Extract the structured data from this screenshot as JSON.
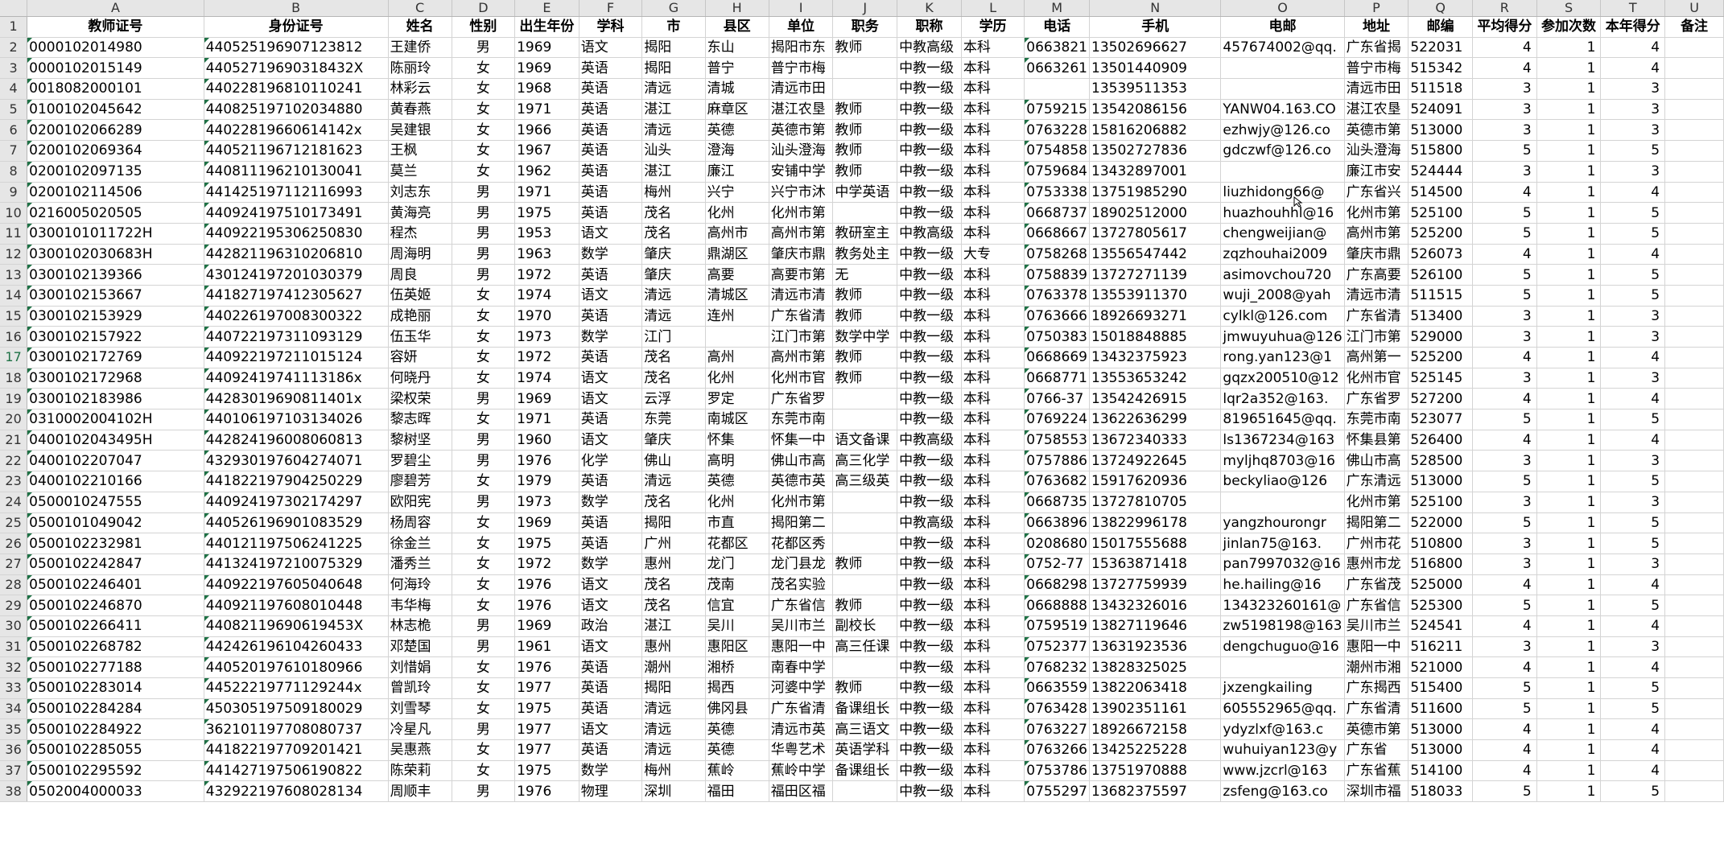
{
  "sheet": {
    "column_letters": [
      "A",
      "B",
      "C",
      "D",
      "E",
      "F",
      "G",
      "H",
      "I",
      "J",
      "K",
      "L",
      "M",
      "N",
      "O",
      "P",
      "Q",
      "R",
      "S",
      "T",
      "U"
    ],
    "headers": [
      "教师证号",
      "身份证号",
      "姓名",
      "性别",
      "出生年份",
      "学科",
      "市",
      "县区",
      "单位",
      "职务",
      "职称",
      "学历",
      "电话",
      "手机",
      "电邮",
      "地址",
      "邮编",
      "平均得分",
      "参加次数",
      "本年得分",
      "备注"
    ],
    "rows": [
      [
        "0000102014980",
        "440525196907123812",
        "王建侨",
        "男",
        "1969",
        "语文",
        "揭阳",
        "东山",
        "揭阳市东",
        "教师",
        "中教高级",
        "本科",
        "0663821",
        "13502696627",
        "457674002@qq.",
        "广东省揭",
        "522031",
        "4",
        "1",
        "4",
        ""
      ],
      [
        "0000102015149",
        "44052719690318432X",
        "陈丽玲",
        "女",
        "1969",
        "英语",
        "揭阳",
        "普宁",
        "普宁市梅",
        "",
        "中教一级",
        "本科",
        "0663261",
        "13501440909",
        "",
        "普宁市梅",
        "515342",
        "4",
        "1",
        "4",
        ""
      ],
      [
        "0018082000101",
        "440228196810110241",
        "林彩云",
        "女",
        "1968",
        "英语",
        "清远",
        "清城",
        "清远市田",
        "",
        "中教一级",
        "本科",
        "",
        "13539511353",
        "",
        "清远市田",
        "511518",
        "3",
        "1",
        "3",
        ""
      ],
      [
        "0100102045642",
        "440825197102034880",
        "黄春燕",
        "女",
        "1971",
        "英语",
        "湛江",
        "麻章区",
        "湛江农垦",
        "教师",
        "中教一级",
        "本科",
        "0759215",
        "13542086156",
        "YANW04.163.CO",
        "湛江农垦",
        "524091",
        "3",
        "1",
        "3",
        ""
      ],
      [
        "0200102066289",
        "44022819660614142x",
        "吴建银",
        "女",
        "1966",
        "英语",
        "清远",
        "英德",
        "英德市第",
        "教师",
        "中教一级",
        "本科",
        "0763228",
        "15816206882",
        "ezhwjy@126.co",
        "英德市第",
        "513000",
        "3",
        "1",
        "3",
        ""
      ],
      [
        "0200102069364",
        "440521196712181623",
        "王枫",
        "女",
        "1967",
        "英语",
        "汕头",
        "澄海",
        "汕头澄海",
        "教师",
        "中教一级",
        "本科",
        "0754858",
        "13502727836",
        "gdczwf@126.co",
        "汕头澄海",
        "515800",
        "5",
        "1",
        "5",
        ""
      ],
      [
        "0200102097135",
        "440811196210130041",
        "莫兰",
        "女",
        "1962",
        "英语",
        "湛江",
        "廉江",
        "安铺中学",
        "教师",
        "中教一级",
        "本科",
        "0759684",
        "13432897001",
        "",
        "廉江市安",
        "524444",
        "3",
        "1",
        "3",
        ""
      ],
      [
        "0200102114506",
        "441425197112116993",
        "刘志东",
        "男",
        "1971",
        "英语",
        "梅州",
        "兴宁",
        "兴宁市沐",
        "中学英语",
        "中教一级",
        "本科",
        "0753338",
        "13751985290",
        "liuzhidong66@",
        "广东省兴",
        "514500",
        "4",
        "1",
        "4",
        ""
      ],
      [
        "0216005020505",
        "440924197510173491",
        "黄海亮",
        "男",
        "1975",
        "英语",
        "茂名",
        "化州",
        "化州市第",
        "",
        "中教一级",
        "本科",
        "0668737",
        "18902512000",
        "huazhouhhl@16",
        "化州市第",
        "525100",
        "5",
        "1",
        "5",
        ""
      ],
      [
        "0300101011722H",
        "440922195306250830",
        "程杰",
        "男",
        "1953",
        "语文",
        "茂名",
        "高州市",
        "高州市第",
        "教研室主",
        "中教高级",
        "本科",
        "0668667",
        "13727805617",
        "chengweijian@",
        "高州市第",
        "525200",
        "5",
        "1",
        "5",
        ""
      ],
      [
        "0300102030683H",
        "442821196310206810",
        "周海明",
        "男",
        "1963",
        "数学",
        "肇庆",
        "鼎湖区",
        "肇庆市鼎",
        "教务处主",
        "中教一级",
        "大专",
        "0758268",
        "13556547442",
        "zqzhouhai2009",
        "肇庆市鼎",
        "526073",
        "4",
        "1",
        "4",
        ""
      ],
      [
        "0300102139366",
        "430124197201030379",
        "周良",
        "男",
        "1972",
        "英语",
        "肇庆",
        "高要",
        "高要市第",
        "无",
        "中教一级",
        "本科",
        "0758839",
        "13727271139",
        "asimovchou720",
        "广东高要",
        "526100",
        "5",
        "1",
        "5",
        ""
      ],
      [
        "0300102153667",
        "441827197412305627",
        "伍英姬",
        "女",
        "1974",
        "语文",
        "清远",
        "清城区",
        "清远市清",
        "教师",
        "中教一级",
        "本科",
        "0763378",
        "13553911370",
        "wuji_2008@yah",
        "清远市清",
        "511515",
        "5",
        "1",
        "5",
        ""
      ],
      [
        "0300102153929",
        "440226197008300322",
        "成艳丽",
        "女",
        "1970",
        "英语",
        "清远",
        "连州",
        "广东省清",
        "教师",
        "中教一级",
        "本科",
        "0763666",
        "18926693271",
        "cylkl@126.com",
        "广东省清",
        "513400",
        "3",
        "1",
        "3",
        ""
      ],
      [
        "0300102157922",
        "440722197311093129",
        "伍玉华",
        "女",
        "1973",
        "数学",
        "江门",
        "",
        "江门市第",
        "数学中学",
        "中教一级",
        "本科",
        "0750383",
        "15018848885",
        "jmwuyuhua@126",
        "江门市第",
        "529000",
        "3",
        "1",
        "3",
        ""
      ],
      [
        "0300102172769",
        "440922197211015124",
        "容妍",
        "女",
        "1972",
        "英语",
        "茂名",
        "高州",
        "高州市第",
        "教师",
        "中教一级",
        "本科",
        "0668669",
        "13432375923",
        "rong.yan123@1",
        "高州第一",
        "525200",
        "4",
        "1",
        "4",
        ""
      ],
      [
        "0300102172968",
        "44092419741113186x",
        "何晓丹",
        "女",
        "1974",
        "语文",
        "茂名",
        "化州",
        "化州市官",
        "教师",
        "中教一级",
        "本科",
        "0668771",
        "13553653242",
        "gqzx200510@12",
        "化州市官",
        "525145",
        "3",
        "1",
        "3",
        ""
      ],
      [
        "0300102183986",
        "44283019690811401x",
        "梁权荣",
        "男",
        "1969",
        "语文",
        "云浮",
        "罗定",
        "广东省罗",
        "",
        "中教一级",
        "本科",
        "0766-37",
        "13542426915",
        "lqr2a352@163.",
        "广东省罗",
        "527200",
        "4",
        "1",
        "4",
        ""
      ],
      [
        "0310002004102H",
        "440106197103134026",
        "黎志晖",
        "女",
        "1971",
        "英语",
        "东莞",
        "南城区",
        "东莞市南",
        "",
        "中教一级",
        "本科",
        "0769224",
        "13622636299",
        "819651645@qq.",
        "东莞市南",
        "523077",
        "5",
        "1",
        "5",
        ""
      ],
      [
        "0400102043495H",
        "442824196008060813",
        "黎树坚",
        "男",
        "1960",
        "语文",
        "肇庆",
        "怀集",
        "怀集一中",
        "语文备课",
        "中教高级",
        "本科",
        "0758553",
        "13672340333",
        "ls1367234@163",
        "怀集县第",
        "526400",
        "4",
        "1",
        "4",
        ""
      ],
      [
        "0400102207047",
        "432930197604274071",
        "罗碧尘",
        "男",
        "1976",
        "化学",
        "佛山",
        "高明",
        "佛山市高",
        "高三化学",
        "中教一级",
        "本科",
        "0757886",
        "13724922645",
        "myljhq8703@16",
        "佛山市高",
        "528500",
        "3",
        "1",
        "3",
        ""
      ],
      [
        "0400102210166",
        "441822197904250229",
        "廖碧芳",
        "女",
        "1979",
        "英语",
        "清远",
        "英德",
        "英德市英",
        "高三级英",
        "中教一级",
        "本科",
        "0763682",
        "15917620936",
        "beckyliao@126",
        "广东清远",
        "513000",
        "5",
        "1",
        "5",
        ""
      ],
      [
        "0500010247555",
        "440924197302174297",
        "欧阳宪",
        "男",
        "1973",
        "数学",
        "茂名",
        "化州",
        "化州市第",
        "",
        "中教一级",
        "本科",
        "0668735",
        "13727810705",
        "",
        "化州市第",
        "525100",
        "3",
        "1",
        "3",
        ""
      ],
      [
        "0500101049042",
        "440526196901083529",
        "杨周容",
        "女",
        "1969",
        "英语",
        "揭阳",
        "市直",
        "揭阳第二",
        "",
        "中教高级",
        "本科",
        "0663896",
        "13822996178",
        "yangzhourongr",
        "揭阳第二",
        "522000",
        "5",
        "1",
        "5",
        ""
      ],
      [
        "0500102232981",
        "440121197506241225",
        "徐金兰",
        "女",
        "1975",
        "英语",
        "广州",
        "花都区",
        "花都区秀",
        "",
        "中教一级",
        "本科",
        "0208680",
        "15017555688",
        "jinlan75@163.",
        "广州市花",
        "510800",
        "3",
        "1",
        "5",
        ""
      ],
      [
        "0500102242847",
        "441324197210075329",
        "潘秀兰",
        "女",
        "1972",
        "数学",
        "惠州",
        "龙门",
        "龙门县龙",
        "教师",
        "中教一级",
        "本科",
        "0752-77",
        "15363871418",
        "pan7997032@16",
        "惠州市龙",
        "516800",
        "3",
        "1",
        "3",
        ""
      ],
      [
        "0500102246401",
        "440922197605040648",
        "何海玲",
        "女",
        "1976",
        "语文",
        "茂名",
        "茂南",
        "茂名实验",
        "",
        "中教一级",
        "本科",
        "0668298",
        "13727759939",
        "he.hailing@16",
        "广东省茂",
        "525000",
        "4",
        "1",
        "4",
        ""
      ],
      [
        "0500102246870",
        "440921197608010448",
        "韦华梅",
        "女",
        "1976",
        "语文",
        "茂名",
        "信宜",
        "广东省信",
        "教师",
        "中教一级",
        "本科",
        "0668888",
        "13432326016",
        "134323260161@",
        "广东省信",
        "525300",
        "5",
        "1",
        "5",
        ""
      ],
      [
        "0500102266411",
        "44082119690619453X",
        "林志桅",
        "男",
        "1969",
        "政治",
        "湛江",
        "吴川",
        "吴川市兰",
        "副校长",
        "中教一级",
        "本科",
        "0759519",
        "13827119646",
        "zw5198198@163",
        "吴川市兰",
        "524541",
        "4",
        "1",
        "4",
        ""
      ],
      [
        "0500102268782",
        "442426196104260433",
        "邓楚国",
        "男",
        "1961",
        "语文",
        "惠州",
        "惠阳区",
        "惠阳一中",
        "高三任课",
        "中教一级",
        "本科",
        "0752377",
        "13631923536",
        "dengchuguo@16",
        "惠阳一中",
        "516211",
        "3",
        "1",
        "3",
        ""
      ],
      [
        "0500102277188",
        "440520197610180966",
        "刘惜娟",
        "女",
        "1976",
        "英语",
        "潮州",
        "湘桥",
        "南春中学",
        "",
        "中教一级",
        "本科",
        "0768232",
        "13828325025",
        "",
        "潮州市湘",
        "521000",
        "4",
        "1",
        "4",
        ""
      ],
      [
        "0500102283014",
        "44522219771129244x",
        "曾凯玲",
        "女",
        "1977",
        "英语",
        "揭阳",
        "揭西",
        "河婆中学",
        "教师",
        "中教一级",
        "本科",
        "0663559",
        "13822063418",
        "jxzengkailing",
        "广东揭西",
        "515400",
        "5",
        "1",
        "5",
        ""
      ],
      [
        "0500102284284",
        "450305197509180029",
        "刘雪琴",
        "女",
        "1975",
        "英语",
        "清远",
        "佛冈县",
        "广东省清",
        "备课组长",
        "中教一级",
        "本科",
        "0763428",
        "13902351161",
        "605552965@qq.",
        "广东省清",
        "511600",
        "5",
        "1",
        "5",
        ""
      ],
      [
        "0500102284922",
        "362101197708080737",
        "冷星凡",
        "男",
        "1977",
        "语文",
        "清远",
        "英德",
        "清远市英",
        "高三语文",
        "中教一级",
        "本科",
        "0763227",
        "18926672158",
        "ydyzlxf@163.c",
        "英德市第",
        "513000",
        "4",
        "1",
        "4",
        ""
      ],
      [
        "0500102285055",
        "441822197709201421",
        "吴惠燕",
        "女",
        "1977",
        "英语",
        "清远",
        "英德",
        "华粤艺术",
        "英语学科",
        "中教一级",
        "本科",
        "0763266",
        "13425225228",
        "wuhuiyan123@y",
        "广东省",
        "513000",
        "4",
        "1",
        "4",
        ""
      ],
      [
        "0500102295592",
        "441427197506190822",
        "陈荣莉",
        "女",
        "1975",
        "数学",
        "梅州",
        "蕉岭",
        "蕉岭中学",
        "备课组长",
        "中教一级",
        "本科",
        "0753786",
        "13751970888",
        "www.jzcrl@163",
        "广东省蕉",
        "514100",
        "4",
        "1",
        "4",
        ""
      ],
      [
        "0502004000033",
        "432922197608028134",
        "周顺丰",
        "男",
        "1976",
        "物理",
        "深圳",
        "福田",
        "福田区福",
        "",
        "中教一级",
        "本科",
        "0755297",
        "13682375597",
        "zsfeng@163.co",
        "深圳市福",
        "518033",
        "5",
        "1",
        "5",
        ""
      ]
    ]
  }
}
